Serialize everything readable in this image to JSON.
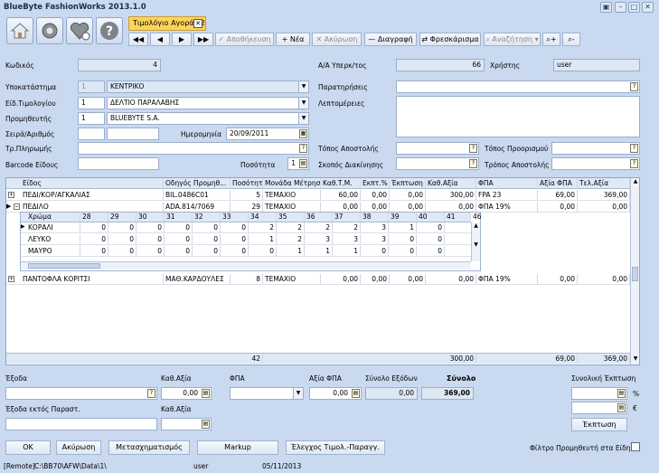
{
  "window": {
    "title": "BlueByte FashionWorks 2013.1.0"
  },
  "tab": {
    "label": "Τιμολόγιο Αγοράς 2"
  },
  "toolbar": {
    "save": "Αποθήκευση",
    "new": "Νέα",
    "cancel": "Ακύρωση",
    "delete": "Διαγραφή",
    "refresh": "Φρεσκάρισμα",
    "search": "Αναζήτηση"
  },
  "form": {
    "code_label": "Κωδικός",
    "code_value": "4",
    "aa_label": "Α/Α Υπερκ/τος",
    "aa_value": "66",
    "user_label": "Χρήστης",
    "user_value": "user",
    "branch_label": "Υποκατάστημα",
    "branch_num": "1",
    "branch_value": "ΚΕΝΤΡΙΚΟ",
    "invtype_label": "Είδ.Τιμολογίου",
    "invtype_num": "1",
    "invtype_value": "ΔΕΛΤΙΟ ΠΑΡΑΛΑΒΗΣ",
    "supplier_label": "Προμηθευτής",
    "supplier_num": "1",
    "supplier_value": "BLUEBYTE S.A.",
    "series_label": "Σειρά/Αριθμός",
    "date_label": "Ημερομηνία",
    "date_value": "20/09/2011",
    "payment_label": "Τρ.Πληρωμής",
    "barcode_label": "Barcode Είδους",
    "qty_label": "Ποσότητα",
    "qty_value": "1",
    "notes_label": "Παρατηρήσεις",
    "details_label": "Λεπτομέρειες",
    "ship_from_label": "Τόπος Αποστολής",
    "ship_to_label": "Τόπος Προορισμού",
    "purpose_label": "Σκοπός Διακίνησης",
    "ship_method_label": "Τρόπος Αποστολής"
  },
  "grid": {
    "headers": [
      "Είδος",
      "Οδηγός Προμηθ...",
      "Ποσότητα",
      "Μονάδα Μέτρησης",
      "Καθ.Τ.Μ.",
      "Εκπτ.%",
      "Έκπτωση",
      "Καθ.Αξία",
      "ΦΠΑ",
      "Αξία ΦΠΑ",
      "Τελ.Αξία"
    ],
    "rows": [
      [
        "ΠΕΔΙ/ΚΟΡ/ΑΓΚΑΛΙΑΣ",
        "BIL.0486C01",
        "5",
        "ΤΕΜΑΧΙΟ",
        "60,00",
        "0,00",
        "0,00",
        "300,00",
        "FPA 23",
        "69,00",
        "369,00"
      ],
      [
        "ΠΕΔΙΛΟ",
        "ADA.814/7069",
        "29",
        "ΤΕΜΑΧΙΟ",
        "0,00",
        "0,00",
        "0,00",
        "0,00",
        "ΦΠΑ 19%",
        "0,00",
        "0,00"
      ],
      [
        "ΠΑΝΤΟΦΛΑ ΚΟΡΙΤΣΙ",
        "ΜΑΘ.ΚΑΡΔΟΥΛΕΣ",
        "8",
        "ΤΕΜΑΧΙΟ",
        "0,00",
        "0,00",
        "0,00",
        "0,00",
        "ΦΠΑ 19%",
        "0,00",
        "0,00"
      ]
    ],
    "sub_headers": [
      "Χρώμα",
      "28",
      "29",
      "30",
      "31",
      "32",
      "33",
      "34",
      "35",
      "36",
      "37",
      "38",
      "39",
      "40",
      "41",
      "46"
    ],
    "sub_rows": [
      [
        "ΚΟΡΑΛΙ",
        "0",
        "0",
        "0",
        "0",
        "0",
        "0",
        "2",
        "2",
        "2",
        "2",
        "3",
        "1",
        "0"
      ],
      [
        "ΛΕΥΚΟ",
        "0",
        "0",
        "0",
        "0",
        "0",
        "0",
        "1",
        "2",
        "3",
        "3",
        "3",
        "0",
        "0"
      ],
      [
        "ΜΑΥΡΟ",
        "0",
        "0",
        "0",
        "0",
        "0",
        "0",
        "0",
        "1",
        "1",
        "1",
        "0",
        "0",
        "0"
      ]
    ],
    "totals": {
      "qty": "42",
      "net": "300,00",
      "vat": "69,00",
      "total": "369,00"
    }
  },
  "bottom": {
    "expense_label": "Έξοδα",
    "net_label": "Καθ.Αξία",
    "net_value": "0,00",
    "vat_label": "ΦΠΑ",
    "vatval_label": "Αξία ΦΠΑ",
    "vatval_value": "0,00",
    "exptotal_label": "Σύνολο Εξόδων",
    "exptotal_value": "0,00",
    "sum_label": "Σύνολο",
    "sum_value": "369,00",
    "disc_label": "Συνολική Έκπτωση",
    "pct": "%",
    "eur": "€",
    "disc_btn": "Έκπτωση",
    "exp_out_label": "Έξοδα εκτός Παραστ.",
    "net2_label": "Καθ.Αξία"
  },
  "buttons": {
    "ok": "OK",
    "cancel": "Ακύρωση",
    "transform": "Μετασχηματισμός",
    "markup": "Markup",
    "check": "Έλεγχος Τιμολ.-Παραγγ.",
    "filter": "Φίλτρο Προμηθευτή στα Είδη"
  },
  "status": {
    "remote": "[Remote]",
    "path": "C:\\BB70\\AFW\\Data\\1\\",
    "user": "user",
    "date": "05/11/2013"
  }
}
